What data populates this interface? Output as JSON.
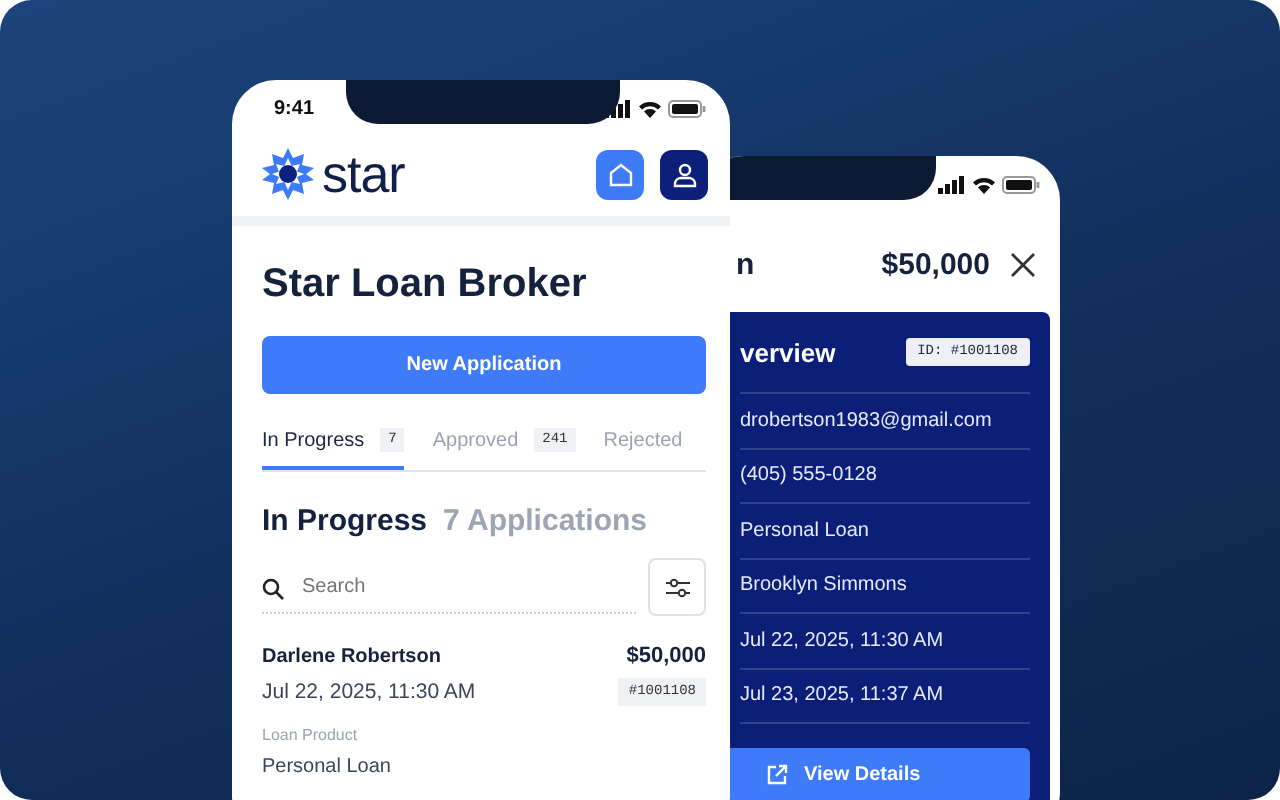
{
  "front_phone": {
    "status_bar": {
      "time": "9:41"
    },
    "logo": {
      "text": "star"
    },
    "title": "Star Loan Broker",
    "primary_button": "New Application",
    "tabs": [
      {
        "label": "In Progress",
        "count": "7",
        "selected": true
      },
      {
        "label": "Approved",
        "count": "241",
        "selected": false
      },
      {
        "label": "Rejected",
        "selected": false
      }
    ],
    "section": {
      "title": "In Progress",
      "count": "7 Applications"
    },
    "search": {
      "placeholder": "Search"
    },
    "application": {
      "name": "Darlene Robertson",
      "amount": "$50,000",
      "date": "Jul 22, 2025, 11:30 AM",
      "id": "#1001108",
      "fields": [
        {
          "label": "Loan Product",
          "value": "Personal Loan"
        }
      ]
    }
  },
  "back_phone": {
    "title": "n",
    "amount": "$50,000",
    "overview": {
      "title": "verview",
      "id": "ID: #1001108",
      "rows": [
        "drobertson1983@gmail.com",
        "(405) 555-0128",
        "Personal Loan",
        "Brooklyn Simmons",
        "Jul 22, 2025, 11:30 AM",
        "Jul 23, 2025, 11:37 AM"
      ],
      "button": "View Details"
    }
  }
}
